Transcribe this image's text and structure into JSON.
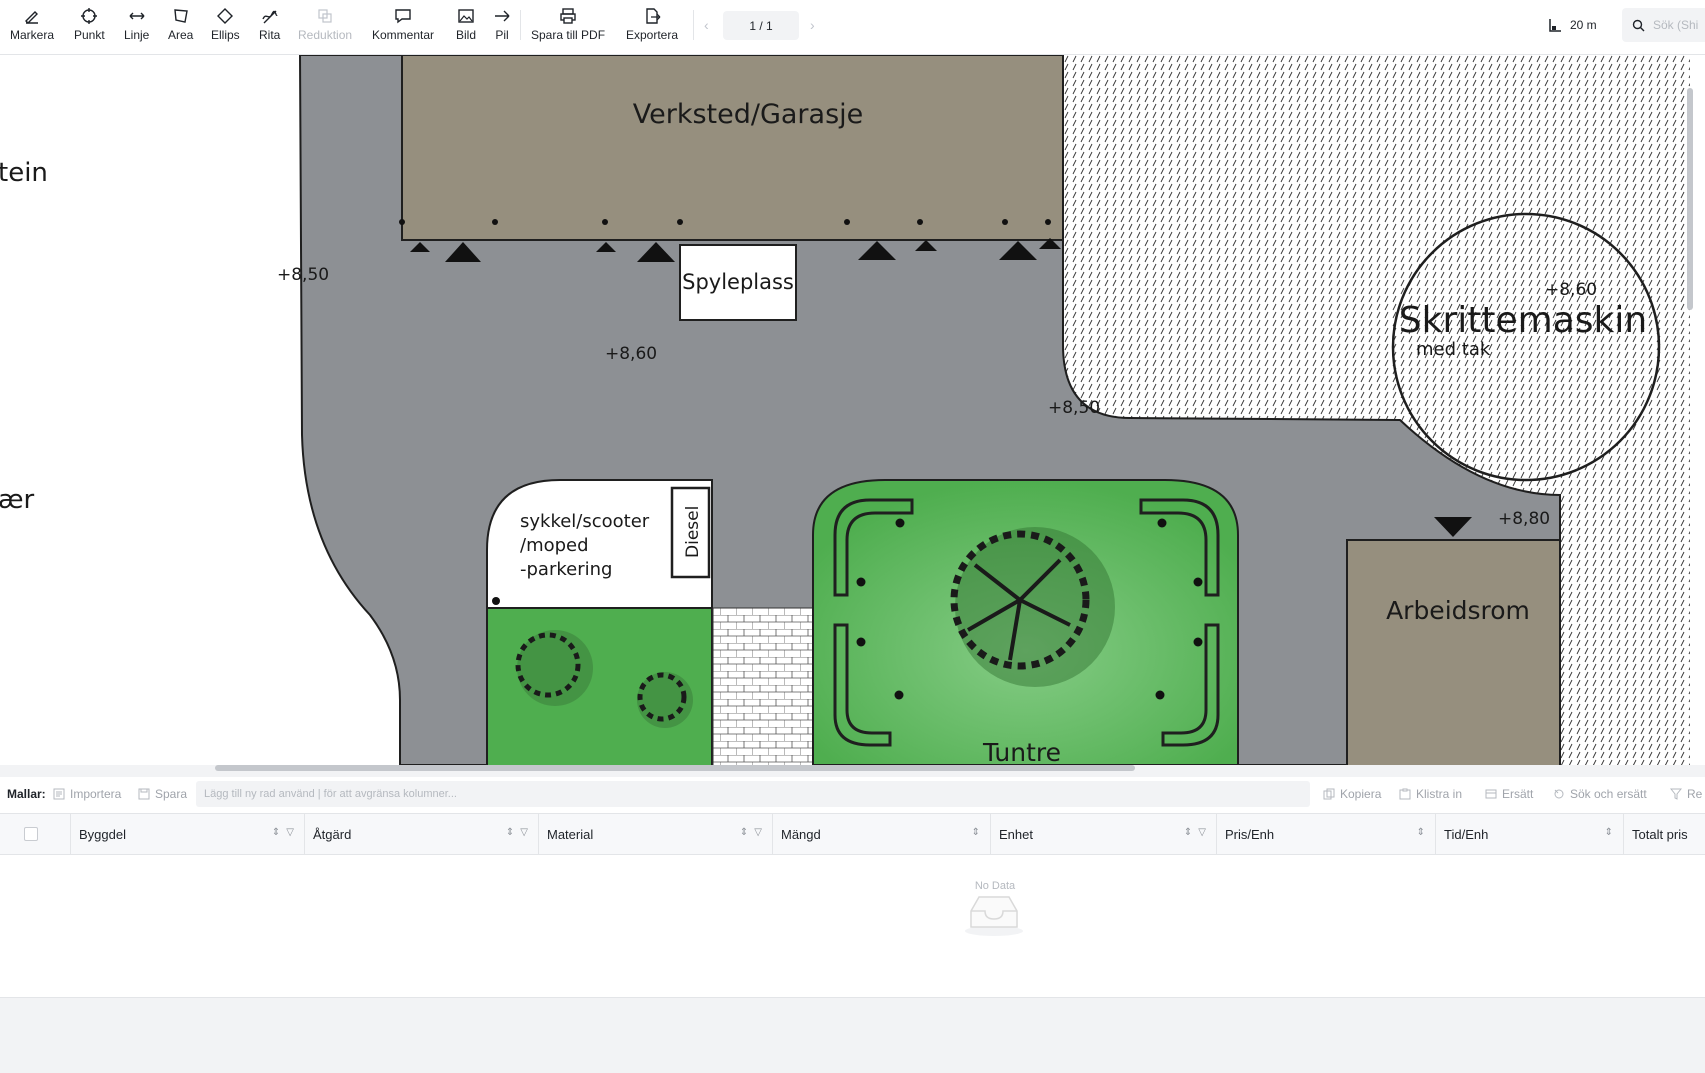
{
  "toolbar": {
    "tools": [
      {
        "label": "Markera",
        "icon": "pen-icon"
      },
      {
        "label": "Punkt",
        "icon": "crosshair-icon"
      },
      {
        "label": "Linje",
        "icon": "double-arrow-icon"
      },
      {
        "label": "Area",
        "icon": "polygon-icon"
      },
      {
        "label": "Ellips",
        "icon": "diamond-icon"
      },
      {
        "label": "Rita",
        "icon": "freehand-icon"
      },
      {
        "label": "Reduktion",
        "icon": "reduction-icon"
      },
      {
        "label": "Kommentar",
        "icon": "comment-icon"
      },
      {
        "label": "Bild",
        "icon": "image-icon"
      },
      {
        "label": "Pil",
        "icon": "arrow-right-icon"
      },
      {
        "label": "Spara till PDF",
        "icon": "printer-icon"
      },
      {
        "label": "Exportera",
        "icon": "export-icon"
      }
    ],
    "page_indicator": "1 / 1",
    "scale_label": "20 m",
    "search_placeholder": "Sök (Shi"
  },
  "plan": {
    "labels": {
      "building_1": "Verksted/Garasje",
      "wash_area": "Spyleplass",
      "machine": "Skrittemaskin",
      "machine_sub": "med tak",
      "parking_line1": "sykkel/scooter",
      "parking_line2": "/moped",
      "parking_line3": "-parkering",
      "diesel": "Diesel",
      "yard": "Tuntre",
      "building_2": "Arbeidsrom",
      "left_word_1": "tein",
      "left_word_2": "ær"
    },
    "elevations": {
      "e1": "+8,50",
      "e2": "+8,60",
      "e3": "+8,50",
      "e4": "+8,60",
      "e5": "+8,80"
    }
  },
  "templates": {
    "label": "Mallar:",
    "import": "Importera",
    "save": "Spara",
    "input_placeholder": "Lägg till ny rad använd | för att avgränsa kolumner...",
    "copy": "Kopiera",
    "paste": "Klistra in",
    "replace": "Ersätt",
    "find_replace": "Sök och ersätt",
    "reset": "Re"
  },
  "table": {
    "columns": [
      {
        "label": "Byggdel"
      },
      {
        "label": "Åtgärd"
      },
      {
        "label": "Material"
      },
      {
        "label": "Mängd"
      },
      {
        "label": "Enhet"
      },
      {
        "label": "Pris/Enh"
      },
      {
        "label": "Tid/Enh"
      },
      {
        "label": "Totalt pris"
      }
    ],
    "empty_text": "No Data"
  },
  "colors": {
    "asphalt": "#8d9094",
    "building": "#968f7e",
    "grass": "#5cb85c",
    "accent": "#1f2329"
  }
}
